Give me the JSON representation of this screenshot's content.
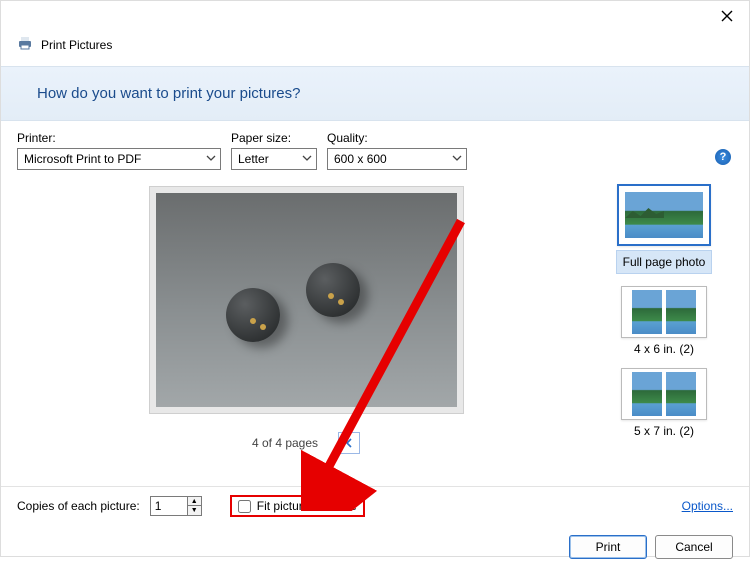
{
  "window": {
    "title": "Print Pictures"
  },
  "banner": {
    "question": "How do you want to print your pictures?"
  },
  "fields": {
    "printer_label": "Printer:",
    "printer_value": "Microsoft Print to PDF",
    "paper_label": "Paper size:",
    "paper_value": "Letter",
    "quality_label": "Quality:",
    "quality_value": "600 x 600"
  },
  "pager": {
    "text": "4 of 4 pages"
  },
  "layouts": {
    "full": "Full page photo",
    "l4x6": "4 x 6 in. (2)",
    "l5x7": "5 x 7 in. (2)"
  },
  "footer": {
    "copies_label": "Copies of each picture:",
    "copies_value": "1",
    "fit_label": "Fit picture to frame",
    "options_link": "Options...",
    "print": "Print",
    "cancel": "Cancel"
  }
}
